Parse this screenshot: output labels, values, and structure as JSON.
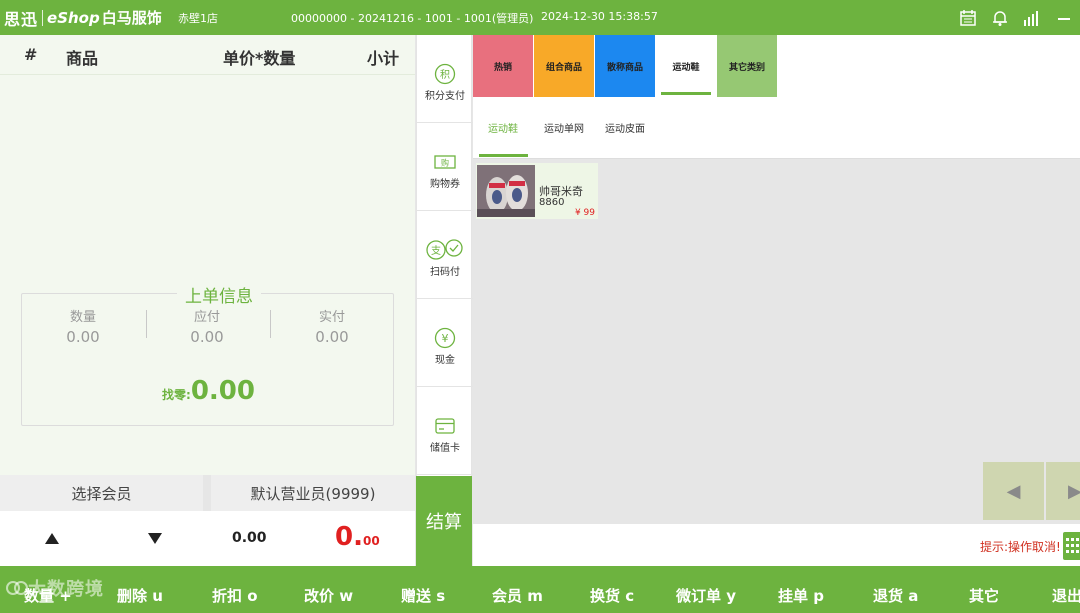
{
  "header": {
    "logo_cn": "思迅",
    "logo_en": "eShop",
    "store_name": "白马服饰",
    "branch": "赤壁1店",
    "session": "00000000 - 20241216 - 1001 - 1001(管理员)",
    "datetime": "2024-12-30 15:38:57",
    "icons": [
      "calendar-icon",
      "bell-icon",
      "signal-icon",
      "minimize-icon"
    ]
  },
  "order": {
    "columns": [
      "#",
      "商品",
      "单价*数量",
      "小计"
    ],
    "prev_title": "上单信息",
    "stats": [
      {
        "label": "数量",
        "value": "0.00"
      },
      {
        "label": "应付",
        "value": "0.00"
      },
      {
        "label": "实付",
        "value": "0.00"
      }
    ],
    "change_label": "找零:",
    "change_value": "0.00",
    "member_label": "选择会员",
    "clerk_label": "默认营业员(9999)",
    "qty_total": "0.00",
    "amount_int": "0.",
    "amount_dec": "00"
  },
  "payments": [
    {
      "label": "积分支付",
      "icon": "points-icon"
    },
    {
      "label": "购物券",
      "icon": "coupon-icon"
    },
    {
      "label": "扫码付",
      "icon": "scan-pay-icon"
    },
    {
      "label": "现金",
      "icon": "cash-icon"
    },
    {
      "label": "储值卡",
      "icon": "stored-card-icon"
    }
  ],
  "checkout_label": "结算",
  "categories": [
    {
      "label": "热销",
      "color": "#e8707e"
    },
    {
      "label": "组合商品",
      "color": "#f8a928"
    },
    {
      "label": "散称商品",
      "color": "#1c88f0"
    },
    {
      "label": "运动鞋",
      "color": "#ffffff"
    },
    {
      "label": "其它类别",
      "color": "#96c873"
    }
  ],
  "subcategories": [
    "运动鞋",
    "运动单网",
    "运动皮面"
  ],
  "products": [
    {
      "name": "帅哥米奇",
      "code": "8860",
      "price": "¥ 99"
    }
  ],
  "status_hint": "提示:操作取消!",
  "function_keys": [
    {
      "label": "数量 +"
    },
    {
      "label": "删除 u"
    },
    {
      "label": "折扣 o"
    },
    {
      "label": "改价 w"
    },
    {
      "label": "赠送 s"
    },
    {
      "label": "会员 m"
    },
    {
      "label": "换货 c"
    },
    {
      "label": "微订单 y"
    },
    {
      "label": "挂单 p"
    },
    {
      "label": "退货 a"
    },
    {
      "label": "其它"
    },
    {
      "label": "退出"
    }
  ],
  "watermark": "大数跨境"
}
